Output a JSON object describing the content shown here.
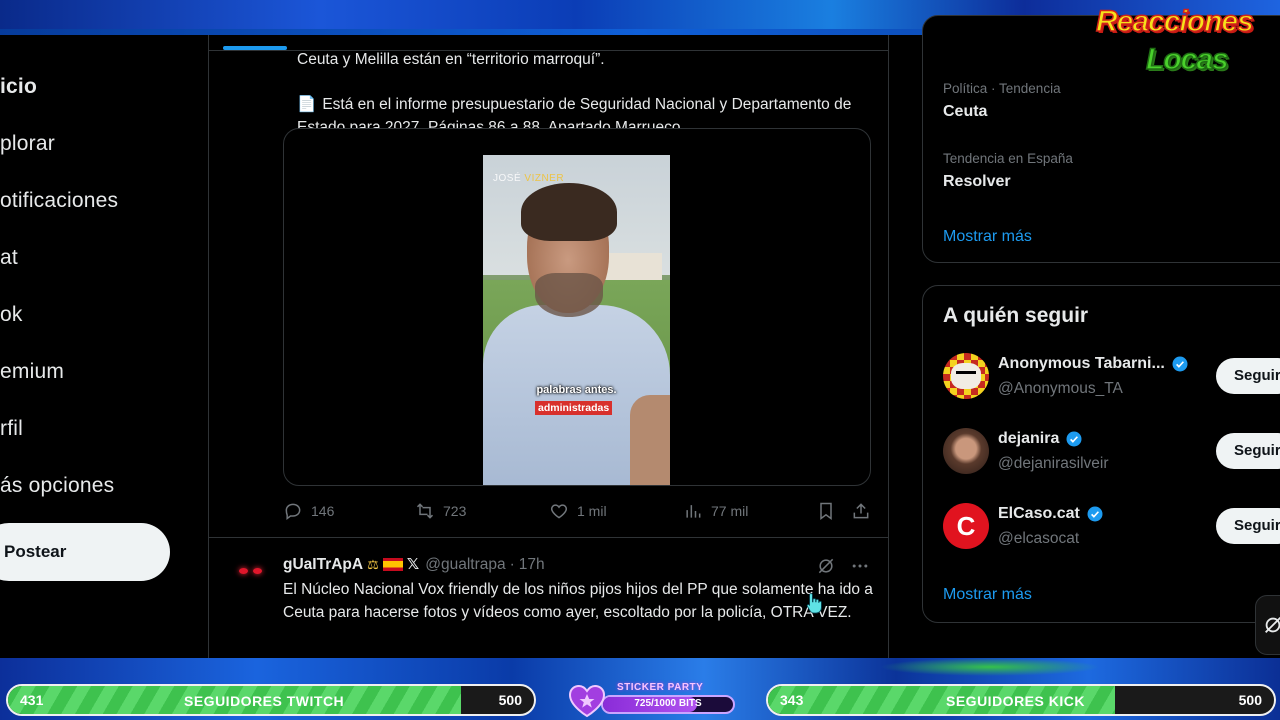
{
  "nav": {
    "items": [
      "icio",
      "plorar",
      "otificaciones",
      "at",
      "ok",
      "emium",
      "rfil",
      "ás opciones"
    ],
    "post_label": "Postear"
  },
  "tweet1": {
    "line1": "Ceuta y Melilla están en “territorio marroquí”.",
    "doc_icon": "📄",
    "line2": "Está en el informe presupuestario de Seguridad Nacional y Departamento de Estado para 2027. Páginas 86 a 88. Apartado Marrueco...",
    "video": {
      "watermark_a": "JOSÉ ",
      "watermark_b": "VIZNER",
      "caption_line1": "palabras antes.",
      "caption_line2": "administradas"
    },
    "stats": {
      "replies": "146",
      "reposts": "723",
      "likes": "1 mil",
      "views": "77 mil"
    }
  },
  "tweet2": {
    "name": "gUaITrApA",
    "handle": "@gualtrapa",
    "separator": "·",
    "time": "17h",
    "text": "El Núcleo Nacional Vox friendly de los niños pijos hijos del PP que solamente ha ido a Ceuta para hacerse fotos y vídeos como ayer, escoltado por la policía, OTRA VEZ."
  },
  "trends": [
    {
      "meta": "Política · Tendencia",
      "title": "Ceuta"
    },
    {
      "meta": "Tendencia en España",
      "title": "Resolver"
    }
  ],
  "trends_show_more": "Mostrar más",
  "who_to_follow": {
    "title": "A quién seguir",
    "users": [
      {
        "name": "Anonymous Tabarni...",
        "handle": "@Anonymous_TA",
        "follow": "Seguir",
        "verified": true
      },
      {
        "name": "dejanira",
        "handle": "@dejanirasilveir",
        "follow": "Seguir",
        "verified": true
      },
      {
        "name": "ElCaso.cat",
        "handle": "@elcasocat",
        "follow": "Seguir",
        "verified": true,
        "avatar_letter": "C"
      }
    ],
    "show_more": "Mostrar más"
  },
  "overlay": {
    "logo_line1": "Reacciones",
    "logo_line2": "Locas",
    "twitch_goal": {
      "current": "431",
      "label": "SEGUIDORES TWITCH",
      "target": "500",
      "progress": 0.862
    },
    "kick_goal": {
      "current": "343",
      "label": "SEGUIDORES KICK",
      "target": "500",
      "progress": 0.686
    },
    "sticker_party": {
      "title": "STICKER PARTY",
      "progress_text": "725/1000 BITS",
      "progress": 0.725
    }
  },
  "colors": {
    "accent": "#1d9bf0",
    "verified": "#1d9bf0",
    "twitch_fill": "#3ec24e",
    "sticker_fill": "#8a2cd8"
  }
}
